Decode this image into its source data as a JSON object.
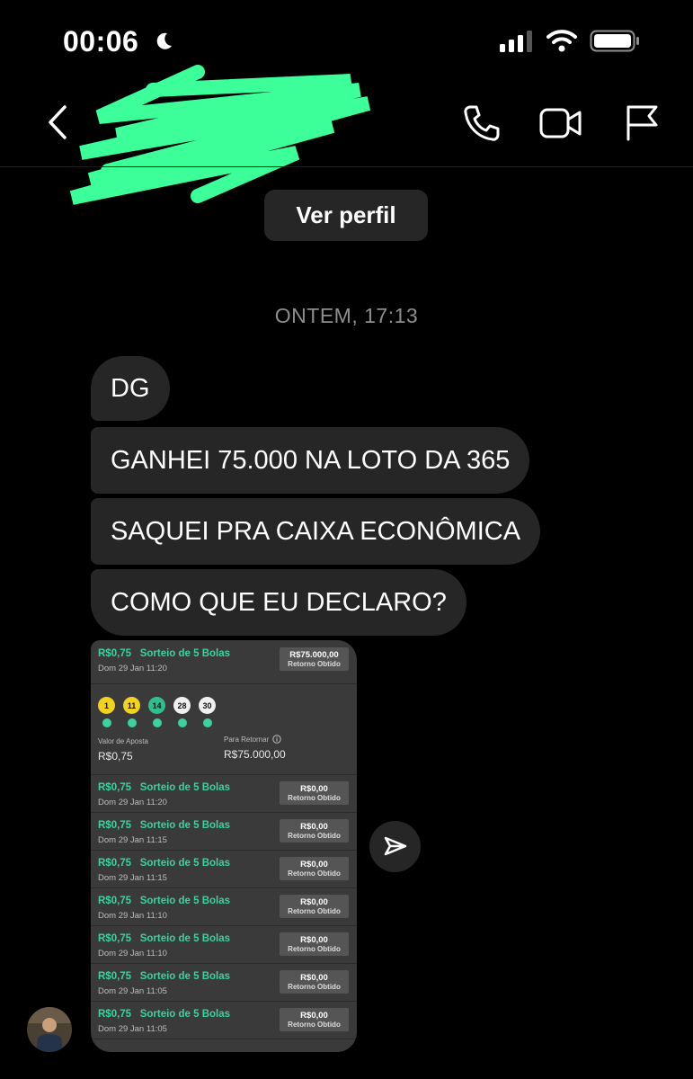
{
  "status_bar": {
    "time": "00:06"
  },
  "header": {
    "view_profile_label": "Ver perfil"
  },
  "conversation": {
    "timestamp": "ONTEM, 17:13",
    "messages": [
      "DG",
      "GANHEI 75.000 NA LOTO DA 365",
      "SAQUEI PRA CAIXA ECONÔMICA",
      "COMO QUE EU DECLARO?"
    ]
  },
  "screenshot": {
    "top_bet": {
      "amount": "R$0,75",
      "title": "Sorteio de 5 Bolas",
      "date": "Dom 29 Jan 11:20",
      "return_value": "R$75.000,00",
      "return_label": "Retorno Obtido"
    },
    "balls": [
      "1",
      "11",
      "14",
      "28",
      "30"
    ],
    "stake_label": "Valor de Aposta",
    "stake_value": "R$0,75",
    "to_return_label": "Para Retornar",
    "to_return_value": "R$75.000,00",
    "bets": [
      {
        "amount": "R$0,75",
        "title": "Sorteio de 5 Bolas",
        "date": "Dom 29 Jan 11:20",
        "return_value": "R$0,00",
        "return_label": "Retorno Obtido"
      },
      {
        "amount": "R$0,75",
        "title": "Sorteio de 5 Bolas",
        "date": "Dom 29 Jan 11:15",
        "return_value": "R$0,00",
        "return_label": "Retorno Obtido"
      },
      {
        "amount": "R$0,75",
        "title": "Sorteio de 5 Bolas",
        "date": "Dom 29 Jan 11:15",
        "return_value": "R$0,00",
        "return_label": "Retorno Obtido"
      },
      {
        "amount": "R$0,75",
        "title": "Sorteio de 5 Bolas",
        "date": "Dom 29 Jan 11:10",
        "return_value": "R$0,00",
        "return_label": "Retorno Obtido"
      },
      {
        "amount": "R$0,75",
        "title": "Sorteio de 5 Bolas",
        "date": "Dom 29 Jan 11:10",
        "return_value": "R$0,00",
        "return_label": "Retorno Obtido"
      },
      {
        "amount": "R$0,75",
        "title": "Sorteio de 5 Bolas",
        "date": "Dom 29 Jan 11:05",
        "return_value": "R$0,00",
        "return_label": "Retorno Obtido"
      },
      {
        "amount": "R$0,75",
        "title": "Sorteio de 5 Bolas",
        "date": "Dom 29 Jan 11:05",
        "return_value": "R$0,00",
        "return_label": "Retorno Obtido"
      }
    ]
  },
  "colors": {
    "background": "#000000",
    "bubble": "#262626",
    "redaction": "#3dff9a",
    "bet_accent": "#3dd1a0",
    "ball_yellow": "#f2d21f",
    "ball_teal": "#2fbf8f",
    "ball_white": "#f0f0f0"
  },
  "icons": [
    "moon-icon",
    "cellular-signal-icon",
    "wifi-icon",
    "battery-icon",
    "back-chevron-icon",
    "phone-icon",
    "video-camera-icon",
    "flag-icon",
    "send-icon",
    "info-icon",
    "check-icon"
  ]
}
